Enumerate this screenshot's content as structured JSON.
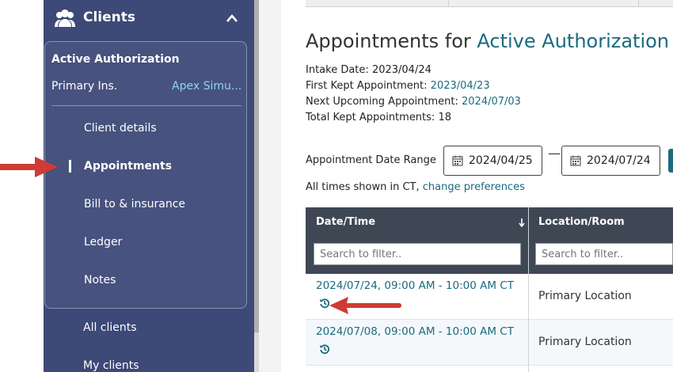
{
  "sidebar": {
    "title": "Clients",
    "card": {
      "title": "Active Authorization",
      "insurance_label": "Primary Ins.",
      "insurance_value": "Apex Simu..."
    },
    "nav": [
      {
        "label": "Client details"
      },
      {
        "label": "Appointments"
      },
      {
        "label": "Bill to & insurance"
      },
      {
        "label": "Ledger"
      },
      {
        "label": "Notes"
      }
    ],
    "outer": [
      {
        "label": "All clients"
      },
      {
        "label": "My clients"
      }
    ]
  },
  "main": {
    "title_prefix": "Appointments for",
    "title_highlight": "Active Authorization",
    "intake_label": "Intake Date:",
    "intake_value": "2023/04/24",
    "first_label": "First Kept Appointment:",
    "first_value": "2023/04/23",
    "next_label": "Next Upcoming Appointment:",
    "next_value": "2024/07/03",
    "total_label": "Total Kept Appointments:",
    "total_value": "18",
    "range_label": "Appointment Date Range",
    "range_start": "2024/04/25",
    "range_sep": "—",
    "range_end": "2024/07/24",
    "tz_text": "All times shown in CT,",
    "tz_link": "change preferences"
  },
  "table": {
    "columns": [
      {
        "label": "Date/Time",
        "filter_placeholder": "Search to filter.."
      },
      {
        "label": "Location/Room",
        "filter_placeholder": "Search to filter.."
      }
    ],
    "rows": [
      {
        "datetime": "2024/07/24, 09:00 AM - 10:00 AM CT",
        "location": "Primary Location"
      },
      {
        "datetime": "2024/07/08, 09:00 AM - 10:00 AM CT",
        "location": "Primary Location"
      }
    ]
  },
  "colors": {
    "sidebar_bg": "#3d4976",
    "accent": "#1b6a80",
    "arrow": "#d03a34",
    "table_header": "#3f4755"
  }
}
